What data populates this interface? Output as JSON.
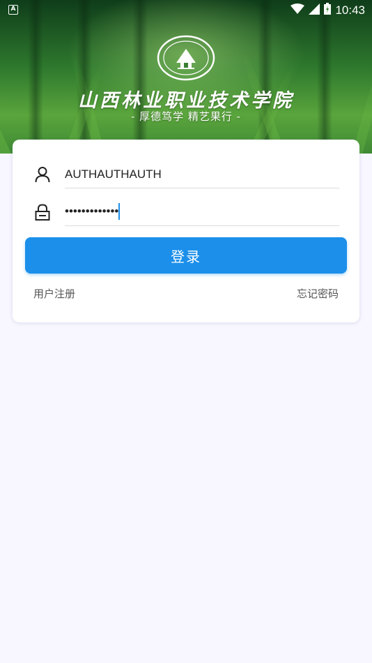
{
  "status_bar": {
    "time": "10:43",
    "left_icon": "a-notification-icon",
    "icons": [
      "wifi-icon",
      "signal-icon",
      "battery-icon"
    ]
  },
  "header": {
    "college_name": "山西林业职业技术学院",
    "motto": "- 厚德笃学  精艺果行 -",
    "logo": "college-emblem"
  },
  "login_form": {
    "username": {
      "value": "AUTHAUTHAUTH",
      "icon": "user-icon"
    },
    "password": {
      "masked_value": "•••••••••••••",
      "icon": "lock-icon"
    },
    "login_button": "登录",
    "register_link": "用户注册",
    "forgot_link": "忘记密码"
  },
  "colors": {
    "accent": "#1b8fea",
    "page_background": "#f8f7ff",
    "card_background": "#ffffff"
  }
}
